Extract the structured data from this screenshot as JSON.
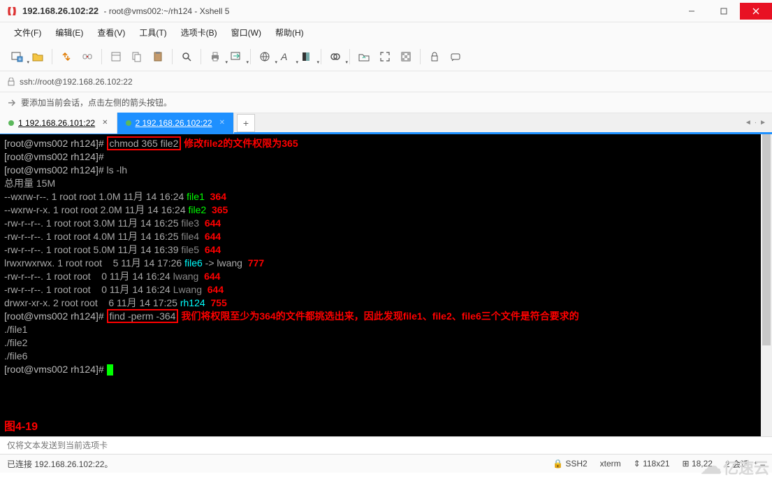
{
  "titlebar": {
    "title": "192.168.26.102:22",
    "subtitle": "root@vms002:~/rh124 - Xshell 5"
  },
  "menu": [
    "文件(F)",
    "编辑(E)",
    "查看(V)",
    "工具(T)",
    "选项卡(B)",
    "窗口(W)",
    "帮助(H)"
  ],
  "addrbar": {
    "url": "ssh://root@192.168.26.102:22"
  },
  "hintbar": {
    "text": "要添加当前会话，点击左侧的箭头按钮。"
  },
  "tabs": [
    {
      "label": "1 192.168.26.101:22",
      "active": false,
      "underline": true
    },
    {
      "label": "2 192.168.26.102:22",
      "active": true,
      "underline": true
    }
  ],
  "inputbar": {
    "placeholder": "仅将文本发送到当前选项卡"
  },
  "statusbar": {
    "left": "已连接 192.168.26.102:22。",
    "ssh": "SSH2",
    "term": "xterm",
    "size": "118x21",
    "pos": "18,22",
    "sessions": "2 会话"
  },
  "watermark": "亿速云",
  "terminal": {
    "prompt": "[root@vms002 rh124]#",
    "cmd1": "chmod 365 file2",
    "note1": "修改file2的文件权限为365",
    "cmd_ls": "ls -lh",
    "total": "总用量 15M",
    "rows": [
      {
        "perm": "--wxrw-r--.",
        "n": "1",
        "u": "root",
        "g": "root",
        "sz": "1.0M",
        "mo": "11月",
        "d": "14",
        "t": "16:24",
        "name": "file1",
        "cls": "g",
        "extra": "",
        "note": "364",
        "ncls": "note-red"
      },
      {
        "perm": "--wxrw-r-x.",
        "n": "1",
        "u": "root",
        "g": "root",
        "sz": "2.0M",
        "mo": "11月",
        "d": "14",
        "t": "16:24",
        "name": "file2",
        "cls": "g",
        "extra": "",
        "note": "365",
        "ncls": "note-red"
      },
      {
        "perm": "-rw-r--r--.",
        "n": "1",
        "u": "root",
        "g": "root",
        "sz": "3.0M",
        "mo": "11月",
        "d": "14",
        "t": "16:25",
        "name": "file3",
        "cls": "gr",
        "extra": "",
        "note": "644",
        "ncls": "note-red"
      },
      {
        "perm": "-rw-r--r--.",
        "n": "1",
        "u": "root",
        "g": "root",
        "sz": "4.0M",
        "mo": "11月",
        "d": "14",
        "t": "16:25",
        "name": "file4",
        "cls": "gr",
        "extra": "",
        "note": "644",
        "ncls": "note-red"
      },
      {
        "perm": "-rw-r--r--.",
        "n": "1",
        "u": "root",
        "g": "root",
        "sz": "5.0M",
        "mo": "11月",
        "d": "14",
        "t": "16:39",
        "name": "file5",
        "cls": "gr",
        "extra": "",
        "note": "644",
        "ncls": "note-red"
      },
      {
        "perm": "lrwxrwxrwx.",
        "n": "1",
        "u": "root",
        "g": "root",
        "sz": "   5",
        "mo": "11月",
        "d": "14",
        "t": "17:26",
        "name": "file6",
        "cls": "c",
        "extra": " -> lwang",
        "note": "777",
        "ncls": "note-red"
      },
      {
        "perm": "-rw-r--r--.",
        "n": "1",
        "u": "root",
        "g": "root",
        "sz": "   0",
        "mo": "11月",
        "d": "14",
        "t": "16:24",
        "name": "lwang",
        "cls": "gr",
        "extra": "",
        "note": "644",
        "ncls": "note-red"
      },
      {
        "perm": "-rw-r--r--.",
        "n": "1",
        "u": "root",
        "g": "root",
        "sz": "   0",
        "mo": "11月",
        "d": "14",
        "t": "16:24",
        "name": "Lwang",
        "cls": "gr",
        "extra": "",
        "note": "644",
        "ncls": "note-red"
      },
      {
        "perm": "drwxr-xr-x.",
        "n": "2",
        "u": "root",
        "g": "root",
        "sz": "   6",
        "mo": "11月",
        "d": "14",
        "t": "17:25",
        "name": "rh124",
        "cls": "c",
        "extra": "",
        "note": "755",
        "ncls": "note-red"
      }
    ],
    "cmd2": "find -perm -364",
    "note2": "我们将权限至少为364的文件都挑选出来，因此发现file1、file2、file6三个文件是符合要求的",
    "results": [
      "./file1",
      "./file2",
      "./file6"
    ],
    "figlabel": "图4-19"
  }
}
